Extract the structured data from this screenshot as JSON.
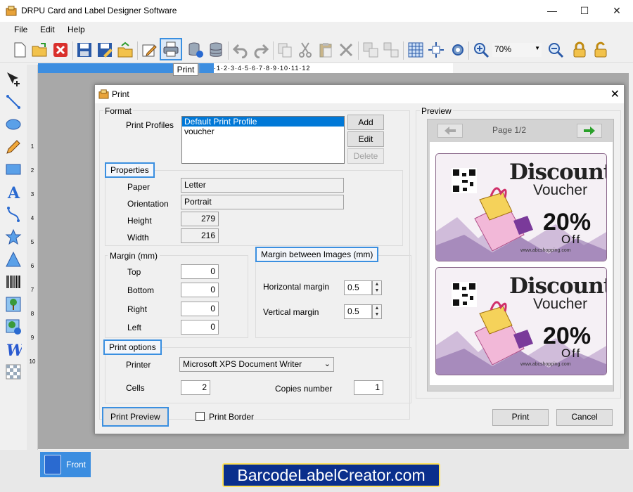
{
  "app": {
    "title": "DRPU Card and Label Designer Software"
  },
  "menu": [
    "File",
    "Edit",
    "Help"
  ],
  "toolbar": {
    "tooltip": "Print",
    "zoom": "70%"
  },
  "ruler": {
    "labels": "·1·2·3·4·5·6·7·8·9·10·11·12"
  },
  "left_ruler_marks": [
    "1",
    "2",
    "3",
    "4",
    "5",
    "6",
    "7",
    "8",
    "9",
    "10"
  ],
  "tabs": {
    "front": "Front"
  },
  "brand": "BarcodeLabelCreator.com",
  "dialog": {
    "title": "Print",
    "format": {
      "label": "Format",
      "profiles_label": "Print Profiles",
      "profiles": [
        "Default Print Profile",
        "voucher"
      ],
      "add": "Add",
      "edit": "Edit",
      "delete": "Delete"
    },
    "properties": {
      "label": "Properties",
      "paper_label": "Paper",
      "paper": "Letter",
      "orientation_label": "Orientation",
      "orientation": "Portrait",
      "height_label": "Height",
      "height": "279",
      "width_label": "Width",
      "width": "216"
    },
    "margin": {
      "label": "Margin (mm)",
      "top_label": "Top",
      "top": "0",
      "bottom_label": "Bottom",
      "bottom": "0",
      "right_label": "Right",
      "right": "0",
      "left_label": "Left",
      "left": "0"
    },
    "margin_between": {
      "label": "Margin between Images (mm)",
      "horizontal_label": "Horizontal margin",
      "horizontal": "0.5",
      "vertical_label": "Vertical margin",
      "vertical": "0.5"
    },
    "print_options": {
      "label": "Print options",
      "printer_label": "Printer",
      "printer": "Microsoft XPS Document Writer",
      "cells_label": "Cells",
      "cells": "2",
      "copies_label": "Copies number",
      "copies": "1"
    },
    "print_preview": "Print Preview",
    "print_border": "Print Border",
    "print": "Print",
    "cancel": "Cancel",
    "preview": {
      "label": "Preview",
      "page": "Page 1/2",
      "voucher_title": "Discount",
      "voucher_sub": "Voucher",
      "voucher_pct": "20%",
      "voucher_off": "Off",
      "voucher_url": "www.abcshopping.com"
    }
  }
}
